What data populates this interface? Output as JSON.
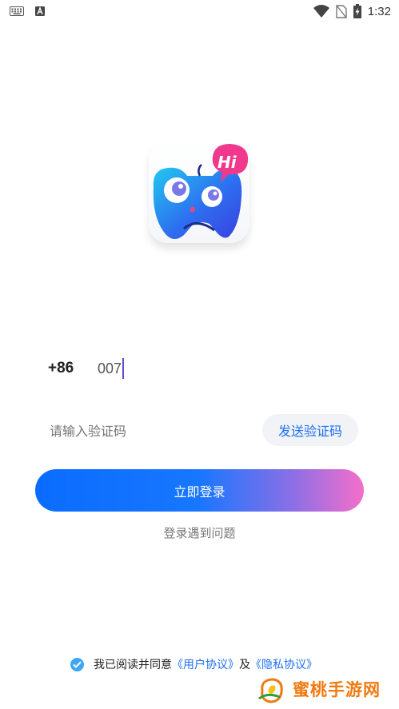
{
  "status_bar": {
    "time": "1:32",
    "icons": [
      "keyboard-icon",
      "a-icon",
      "wifi-icon",
      "no-sim-icon",
      "battery-charging-icon"
    ]
  },
  "login": {
    "country_code": "+86",
    "phone_value": "007",
    "code_placeholder": "请输入验证码",
    "send_code_label": "发送验证码",
    "login_label": "立即登录",
    "help_label": "登录遇到问题"
  },
  "agreement": {
    "prefix": "我已阅读并同意",
    "user_agreement": "《用户协议》",
    "and": "及",
    "privacy_policy": "《隐私协议》",
    "checked": true
  },
  "logo": {
    "bubble_text": "Hi"
  },
  "watermark": {
    "text": "蜜桃手游网"
  },
  "colors": {
    "accent": "#1e6ff0",
    "caret": "#6a49c8",
    "gradient_start": "#0a6cff",
    "gradient_end": "#f46fc9",
    "watermark": "#f07a10"
  }
}
